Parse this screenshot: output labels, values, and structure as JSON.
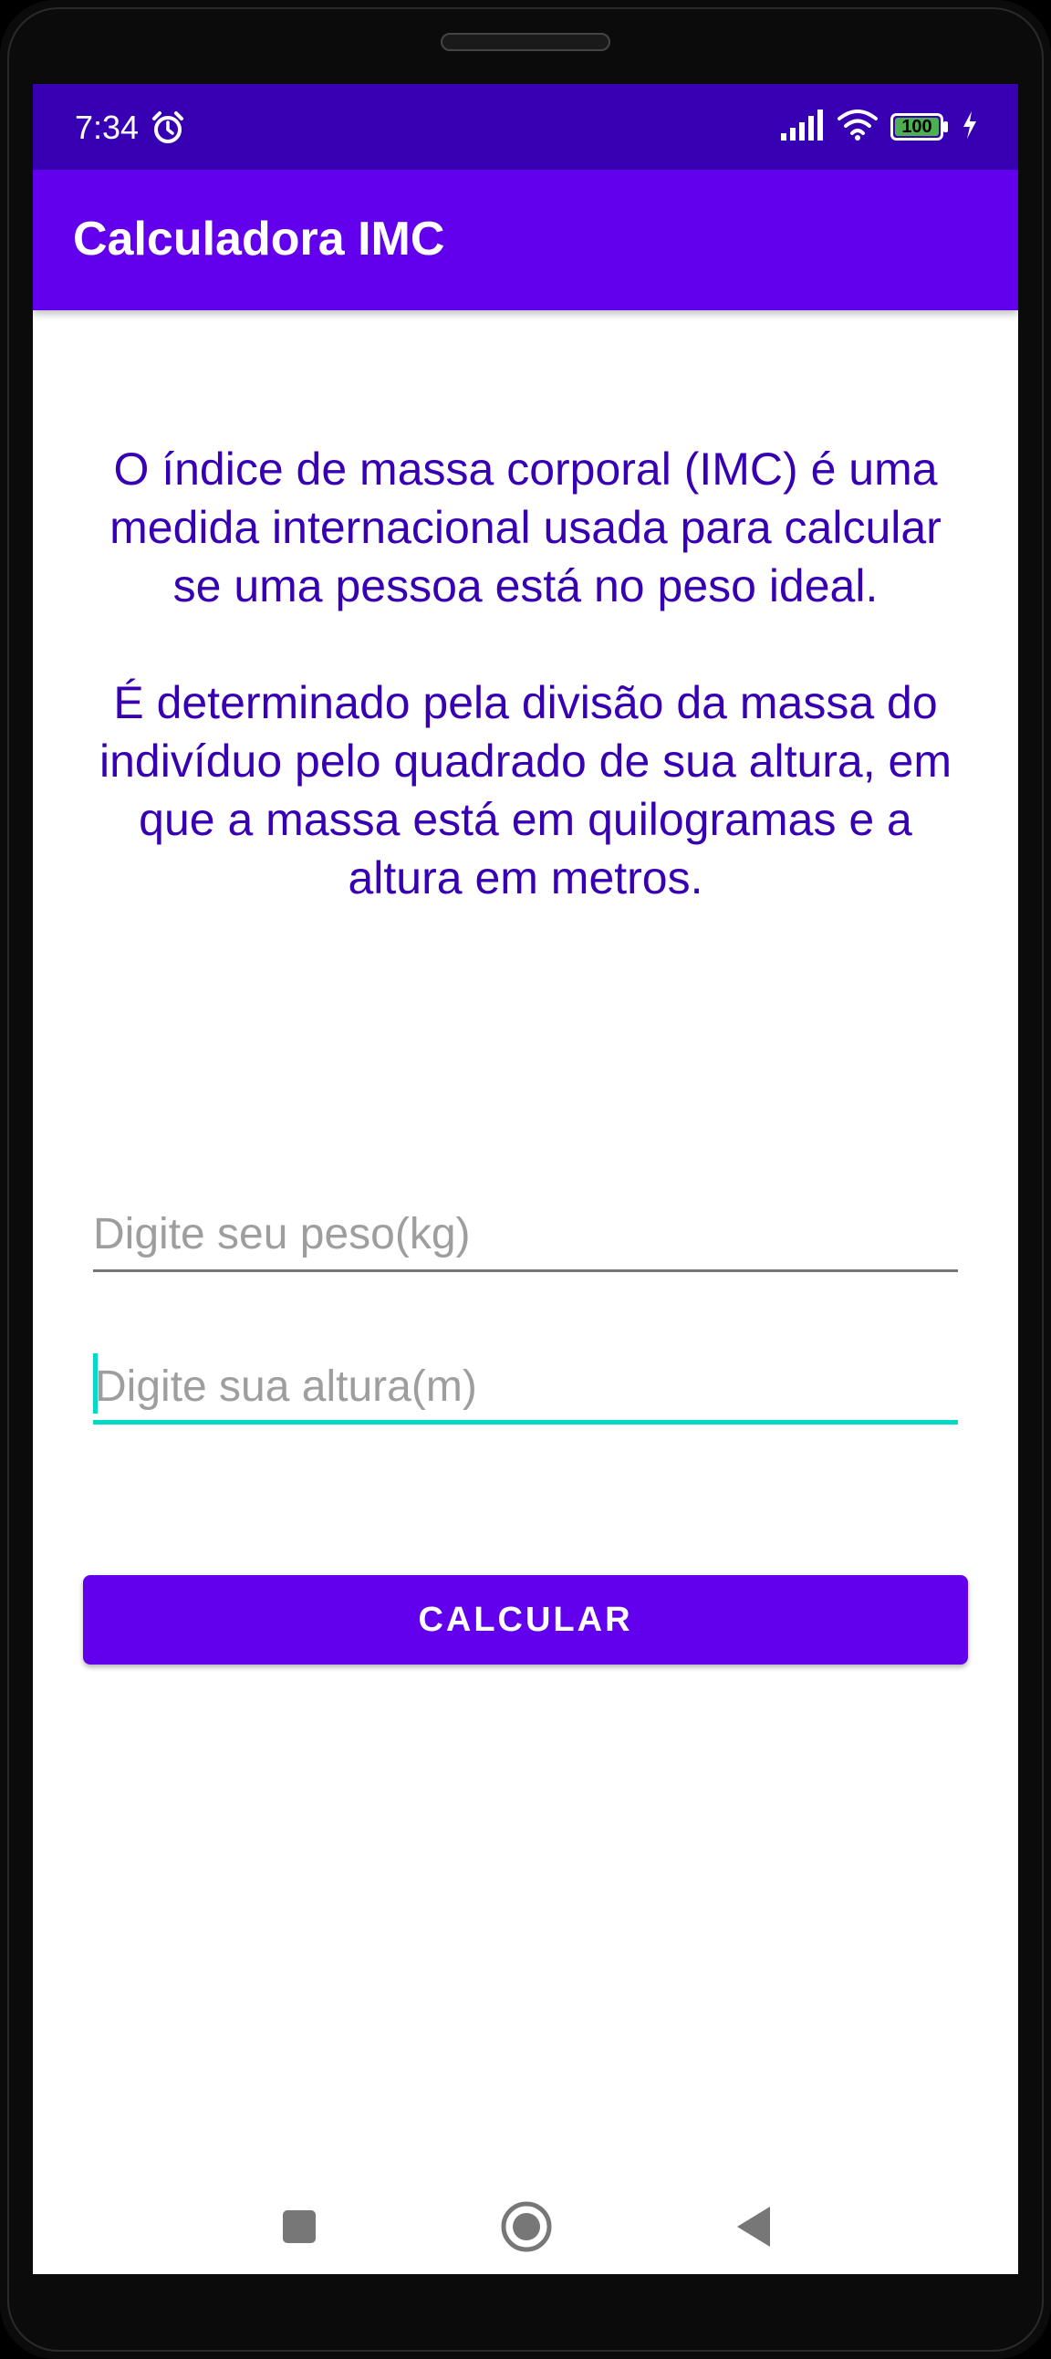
{
  "status_bar": {
    "time": "7:34",
    "battery": "100",
    "icons": [
      "alarm-icon",
      "signal-icon",
      "wifi-icon",
      "battery-icon",
      "charging-icon"
    ]
  },
  "app_bar": {
    "title": "Calculadora IMC"
  },
  "description": {
    "paragraph1": "O índice de massa corporal (IMC) é uma medida internacional usada para calcular se uma pessoa está no peso ideal.",
    "paragraph2": "É determinado pela divisão da massa do indivíduo pelo quadrado de sua altura, em que a massa está em quilogramas e a altura em metros."
  },
  "form": {
    "weight_placeholder": "Digite seu peso(kg)",
    "weight_value": "",
    "height_placeholder": "Digite sua altura(m)",
    "height_value": "",
    "calculate_label": "CALCULAR"
  },
  "nav_bar": {
    "icons": [
      "recents-square-icon",
      "home-circle-icon",
      "back-triangle-icon"
    ]
  },
  "colors": {
    "status_bar": "#3700B3",
    "app_bar": "#6200EE",
    "text_primary": "#3700B3",
    "accent": "#03DAC5",
    "button": "#6200EE"
  }
}
